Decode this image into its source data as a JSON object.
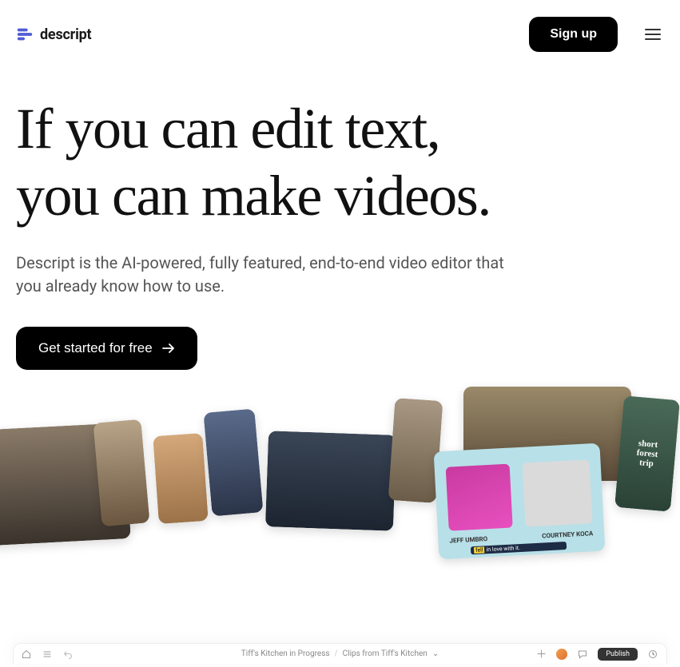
{
  "brand": {
    "name": "descript"
  },
  "header": {
    "signup_label": "Sign up"
  },
  "hero": {
    "title_line1": "If you can edit text,",
    "title_line2": "you can make videos.",
    "subtitle": "Descript is the AI-powered, fully featured, end-to-end video editor that you already know how to use.",
    "cta_label": "Get started for free"
  },
  "strip": {
    "podcast": {
      "name_left": "JEFF UMBRO",
      "name_right": "COURTNEY KOCA",
      "caption_highlight": "fell",
      "caption_rest": "in love with it."
    },
    "forest": {
      "line1": "short",
      "line2": "forest",
      "line3": "trip"
    }
  },
  "editor": {
    "breadcrumb_project": "Tiff's Kitchen in Progress",
    "breadcrumb_clip": "Clips from Tiff's Kitchen",
    "publish_label": "Publish"
  }
}
